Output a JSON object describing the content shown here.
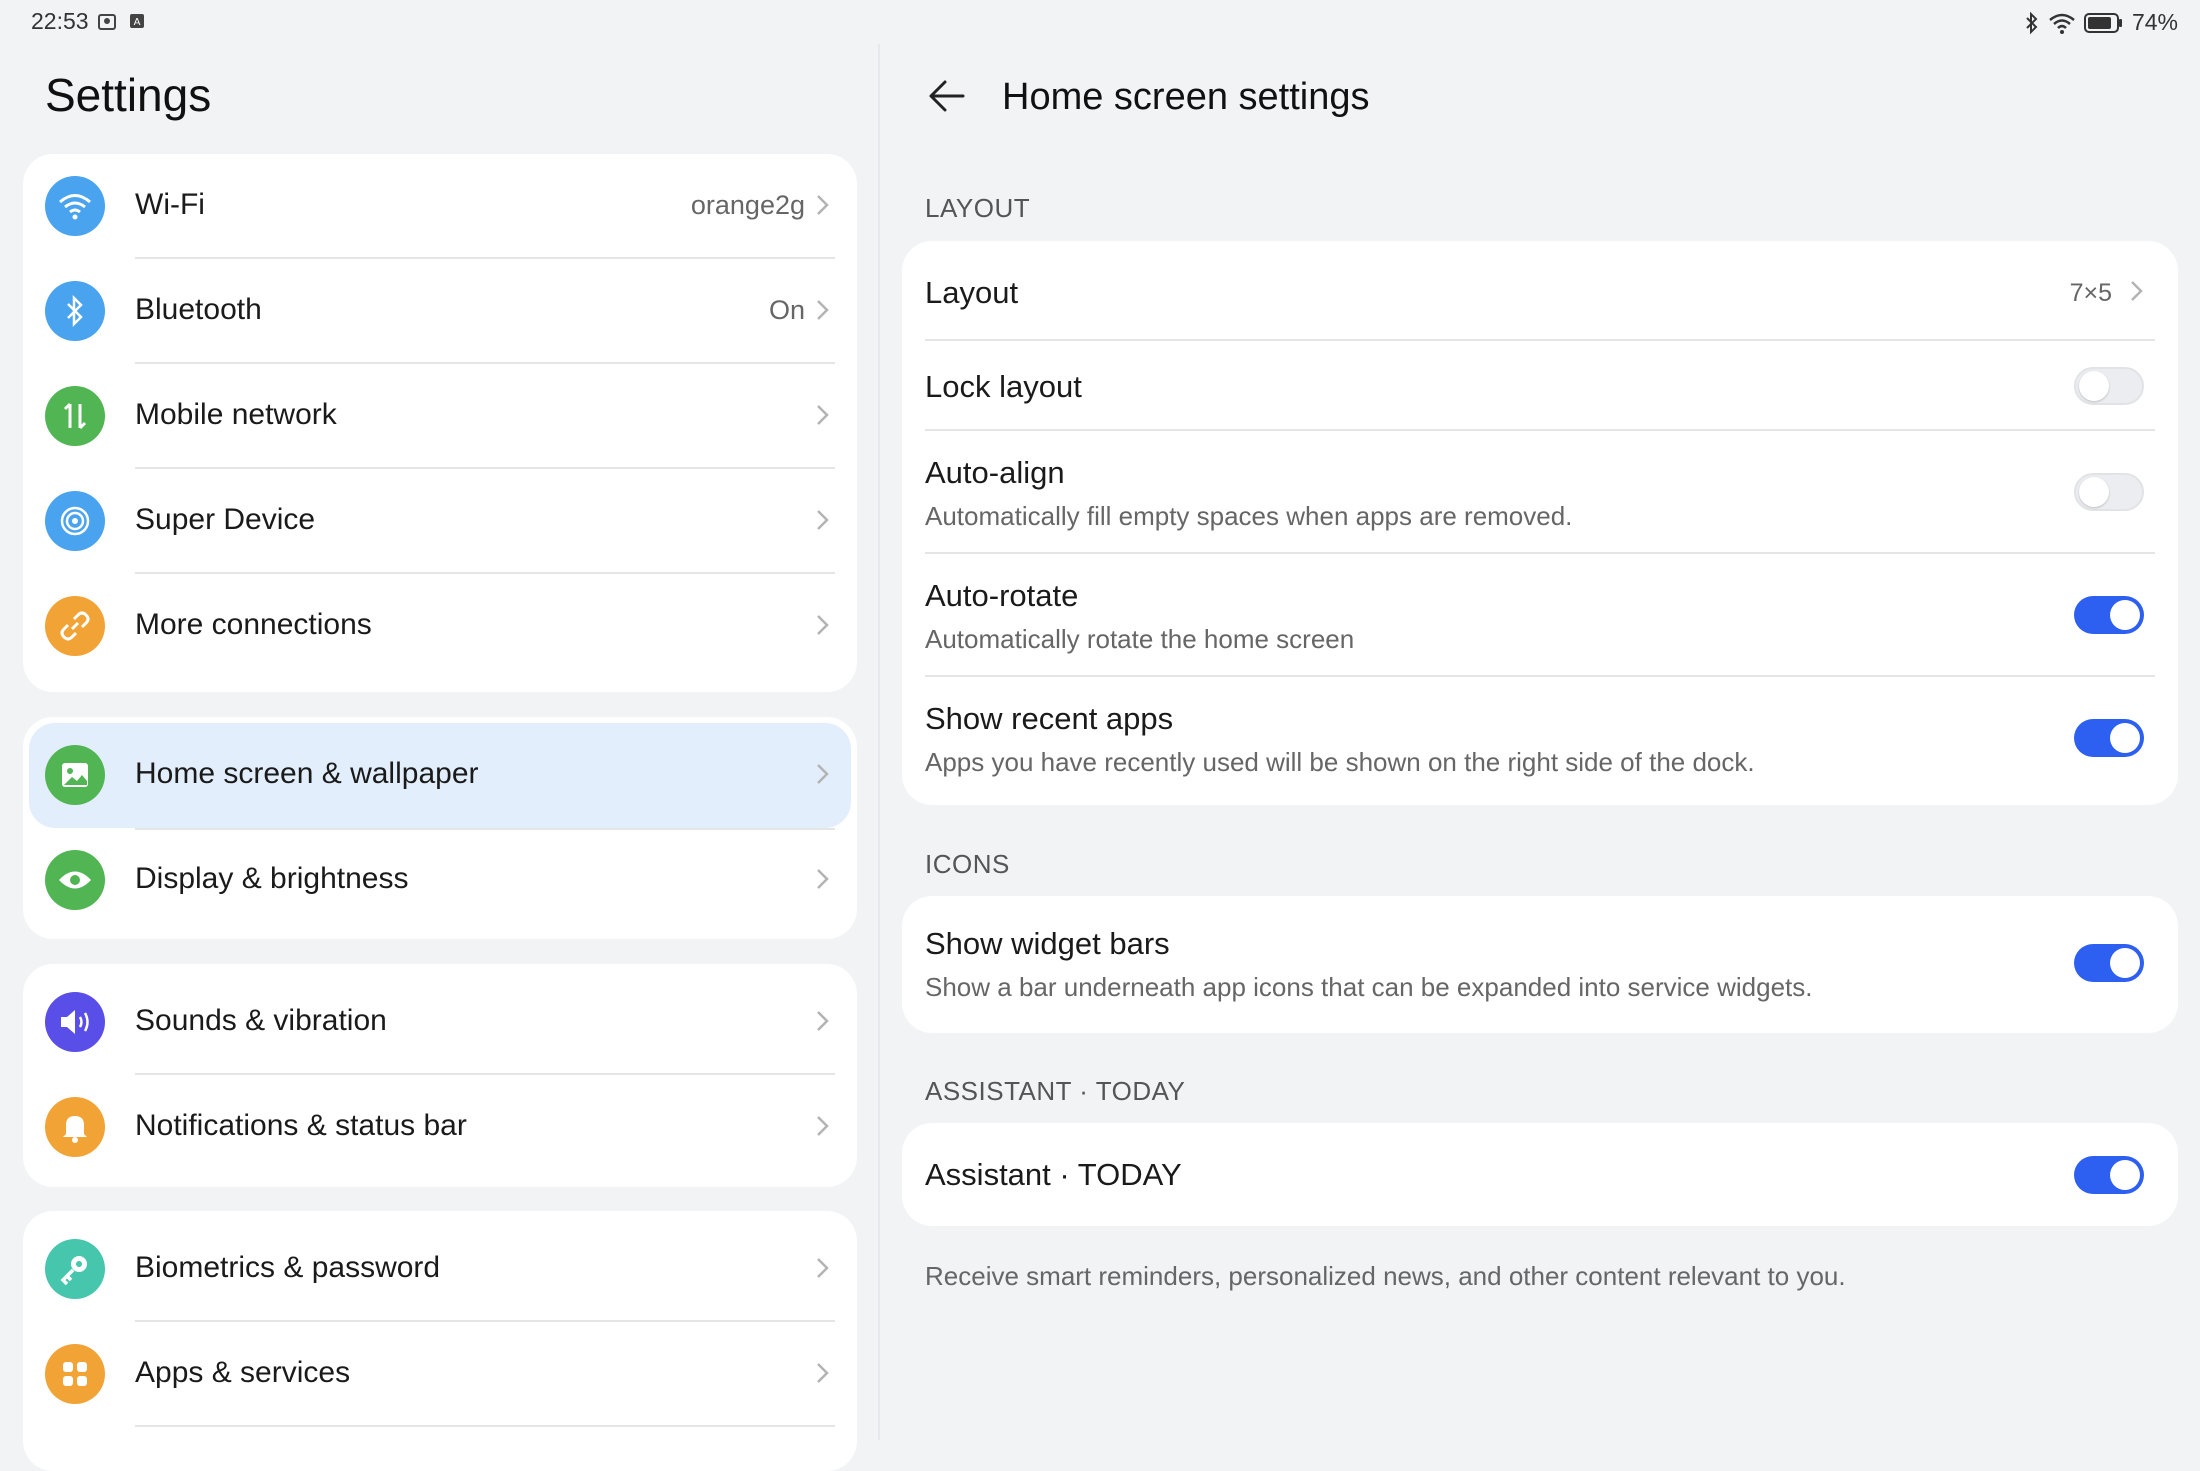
{
  "status_bar": {
    "time": "22:53",
    "battery": "74%"
  },
  "left": {
    "title": "Settings",
    "groups": [
      [
        {
          "label": "Wi-Fi",
          "value": "orange2g",
          "icon": "wifi-icon",
          "color": "#3d97e8"
        },
        {
          "label": "Bluetooth",
          "value": "On",
          "icon": "bluetooth-icon",
          "color": "#3d97e8"
        },
        {
          "label": "Mobile network",
          "value": "",
          "icon": "mobile-data-icon",
          "color": "#4cb34f"
        },
        {
          "label": "Super Device",
          "value": "",
          "icon": "super-device-icon",
          "color": "#3d97e8"
        },
        {
          "label": "More connections",
          "value": "",
          "icon": "link-icon",
          "color": "#f0a030"
        }
      ],
      [
        {
          "label": "Home screen & wallpaper",
          "value": "",
          "icon": "image-icon",
          "color": "#4cb34f",
          "selected": true
        },
        {
          "label": "Display & brightness",
          "value": "",
          "icon": "eye-icon",
          "color": "#4cb34f"
        }
      ],
      [
        {
          "label": "Sounds & vibration",
          "value": "",
          "icon": "speaker-icon",
          "color": "#5a4ee8"
        },
        {
          "label": "Notifications & status bar",
          "value": "",
          "icon": "bell-icon",
          "color": "#f0a030"
        }
      ],
      [
        {
          "label": "Biometrics & password",
          "value": "",
          "icon": "key-icon",
          "color": "#3fc0a8"
        },
        {
          "label": "Apps & services",
          "value": "",
          "icon": "apps-icon",
          "color": "#f0a030"
        }
      ]
    ]
  },
  "right": {
    "title": "Home screen settings",
    "sections": {
      "layout": "LAYOUT",
      "icons": "ICONS",
      "assistant": "ASSISTANT · TODAY"
    },
    "layout_rows": {
      "layout": {
        "title": "Layout",
        "value": "7×5"
      },
      "lock_layout": {
        "title": "Lock layout",
        "on": false
      },
      "auto_align": {
        "title": "Auto-align",
        "subtitle": "Automatically fill empty spaces when apps are removed.",
        "on": false
      },
      "auto_rotate": {
        "title": "Auto-rotate",
        "subtitle": "Automatically rotate the home screen",
        "on": true
      },
      "show_recent": {
        "title": "Show recent apps",
        "subtitle": "Apps you have recently used will be shown on the right side of the dock.",
        "on": true
      }
    },
    "icons_rows": {
      "widget_bars": {
        "title": "Show widget bars",
        "subtitle": "Show a bar underneath app icons that can be expanded into service widgets.",
        "on": true
      }
    },
    "assistant_rows": {
      "assistant_today": {
        "title": "Assistant · TODAY",
        "on": true
      }
    },
    "footnote": "Receive smart reminders, personalized news, and other content relevant to you."
  },
  "colors": {
    "accent": "#2d5ff0",
    "selected_row": "#e3eefc",
    "background": "#f1f3f5"
  }
}
